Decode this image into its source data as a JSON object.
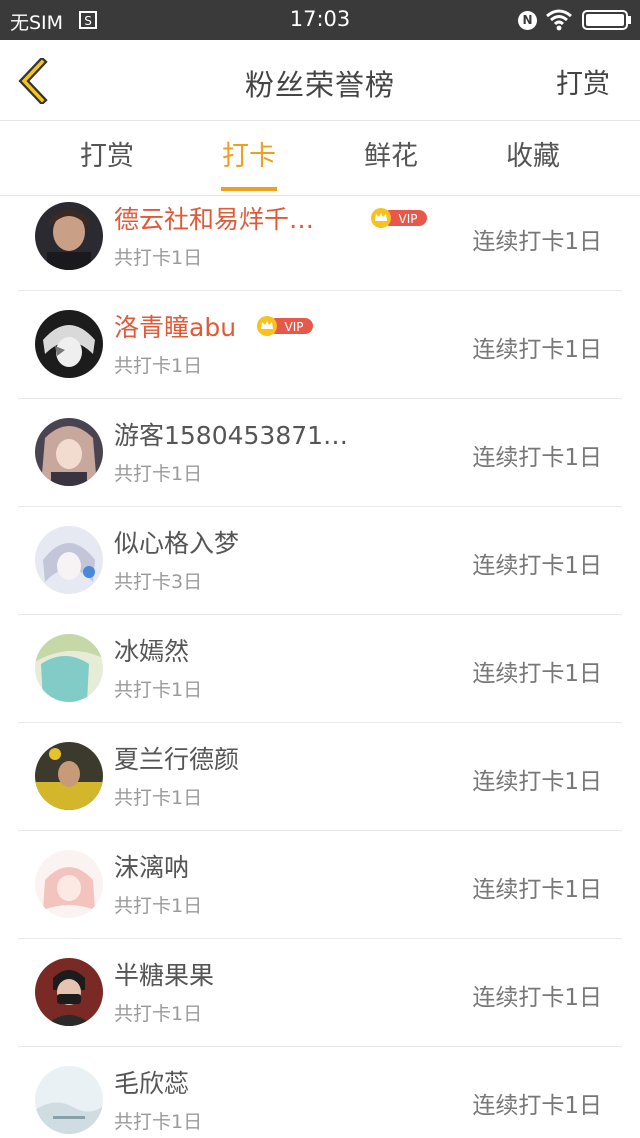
{
  "status_bar": {
    "carrier": "无SIM",
    "time": "17:03",
    "icons": [
      "sim-icon",
      "n-icon",
      "wifi-icon",
      "battery-icon"
    ],
    "n_label": "N"
  },
  "header": {
    "title": "粉丝荣誉榜",
    "action": "打赏",
    "back_icon": "back-chevron-icon"
  },
  "tabs": [
    {
      "label": "打赏",
      "active": false
    },
    {
      "label": "打卡",
      "active": true
    },
    {
      "label": "鲜花",
      "active": false
    },
    {
      "label": "收藏",
      "active": false
    }
  ],
  "vip_label": "VIP",
  "colors": {
    "accent": "#f0a020",
    "vip_name": "#e05a3a",
    "vip_badge": "#e8584a",
    "status_bar": "#3a3a3a"
  },
  "list": [
    {
      "name": "德云社和易烊千…",
      "vip": true,
      "total": "共打卡1日",
      "streak": "连续打卡1日"
    },
    {
      "name": "洛青瞳abu",
      "vip": true,
      "total": "共打卡1日",
      "streak": "连续打卡1日"
    },
    {
      "name": "游客1580453871…",
      "vip": false,
      "total": "共打卡1日",
      "streak": "连续打卡1日"
    },
    {
      "name": "似心格入梦",
      "vip": false,
      "total": "共打卡3日",
      "streak": "连续打卡1日"
    },
    {
      "name": "冰嫣然",
      "vip": false,
      "total": "共打卡1日",
      "streak": "连续打卡1日"
    },
    {
      "name": "夏兰行德颜",
      "vip": false,
      "total": "共打卡1日",
      "streak": "连续打卡1日"
    },
    {
      "name": "沫漓呐",
      "vip": false,
      "total": "共打卡1日",
      "streak": "连续打卡1日"
    },
    {
      "name": "半糖果果",
      "vip": false,
      "total": "共打卡1日",
      "streak": "连续打卡1日"
    },
    {
      "name": "毛欣蕊",
      "vip": false,
      "total": "共打卡1日",
      "streak": "连续打卡1日"
    }
  ]
}
